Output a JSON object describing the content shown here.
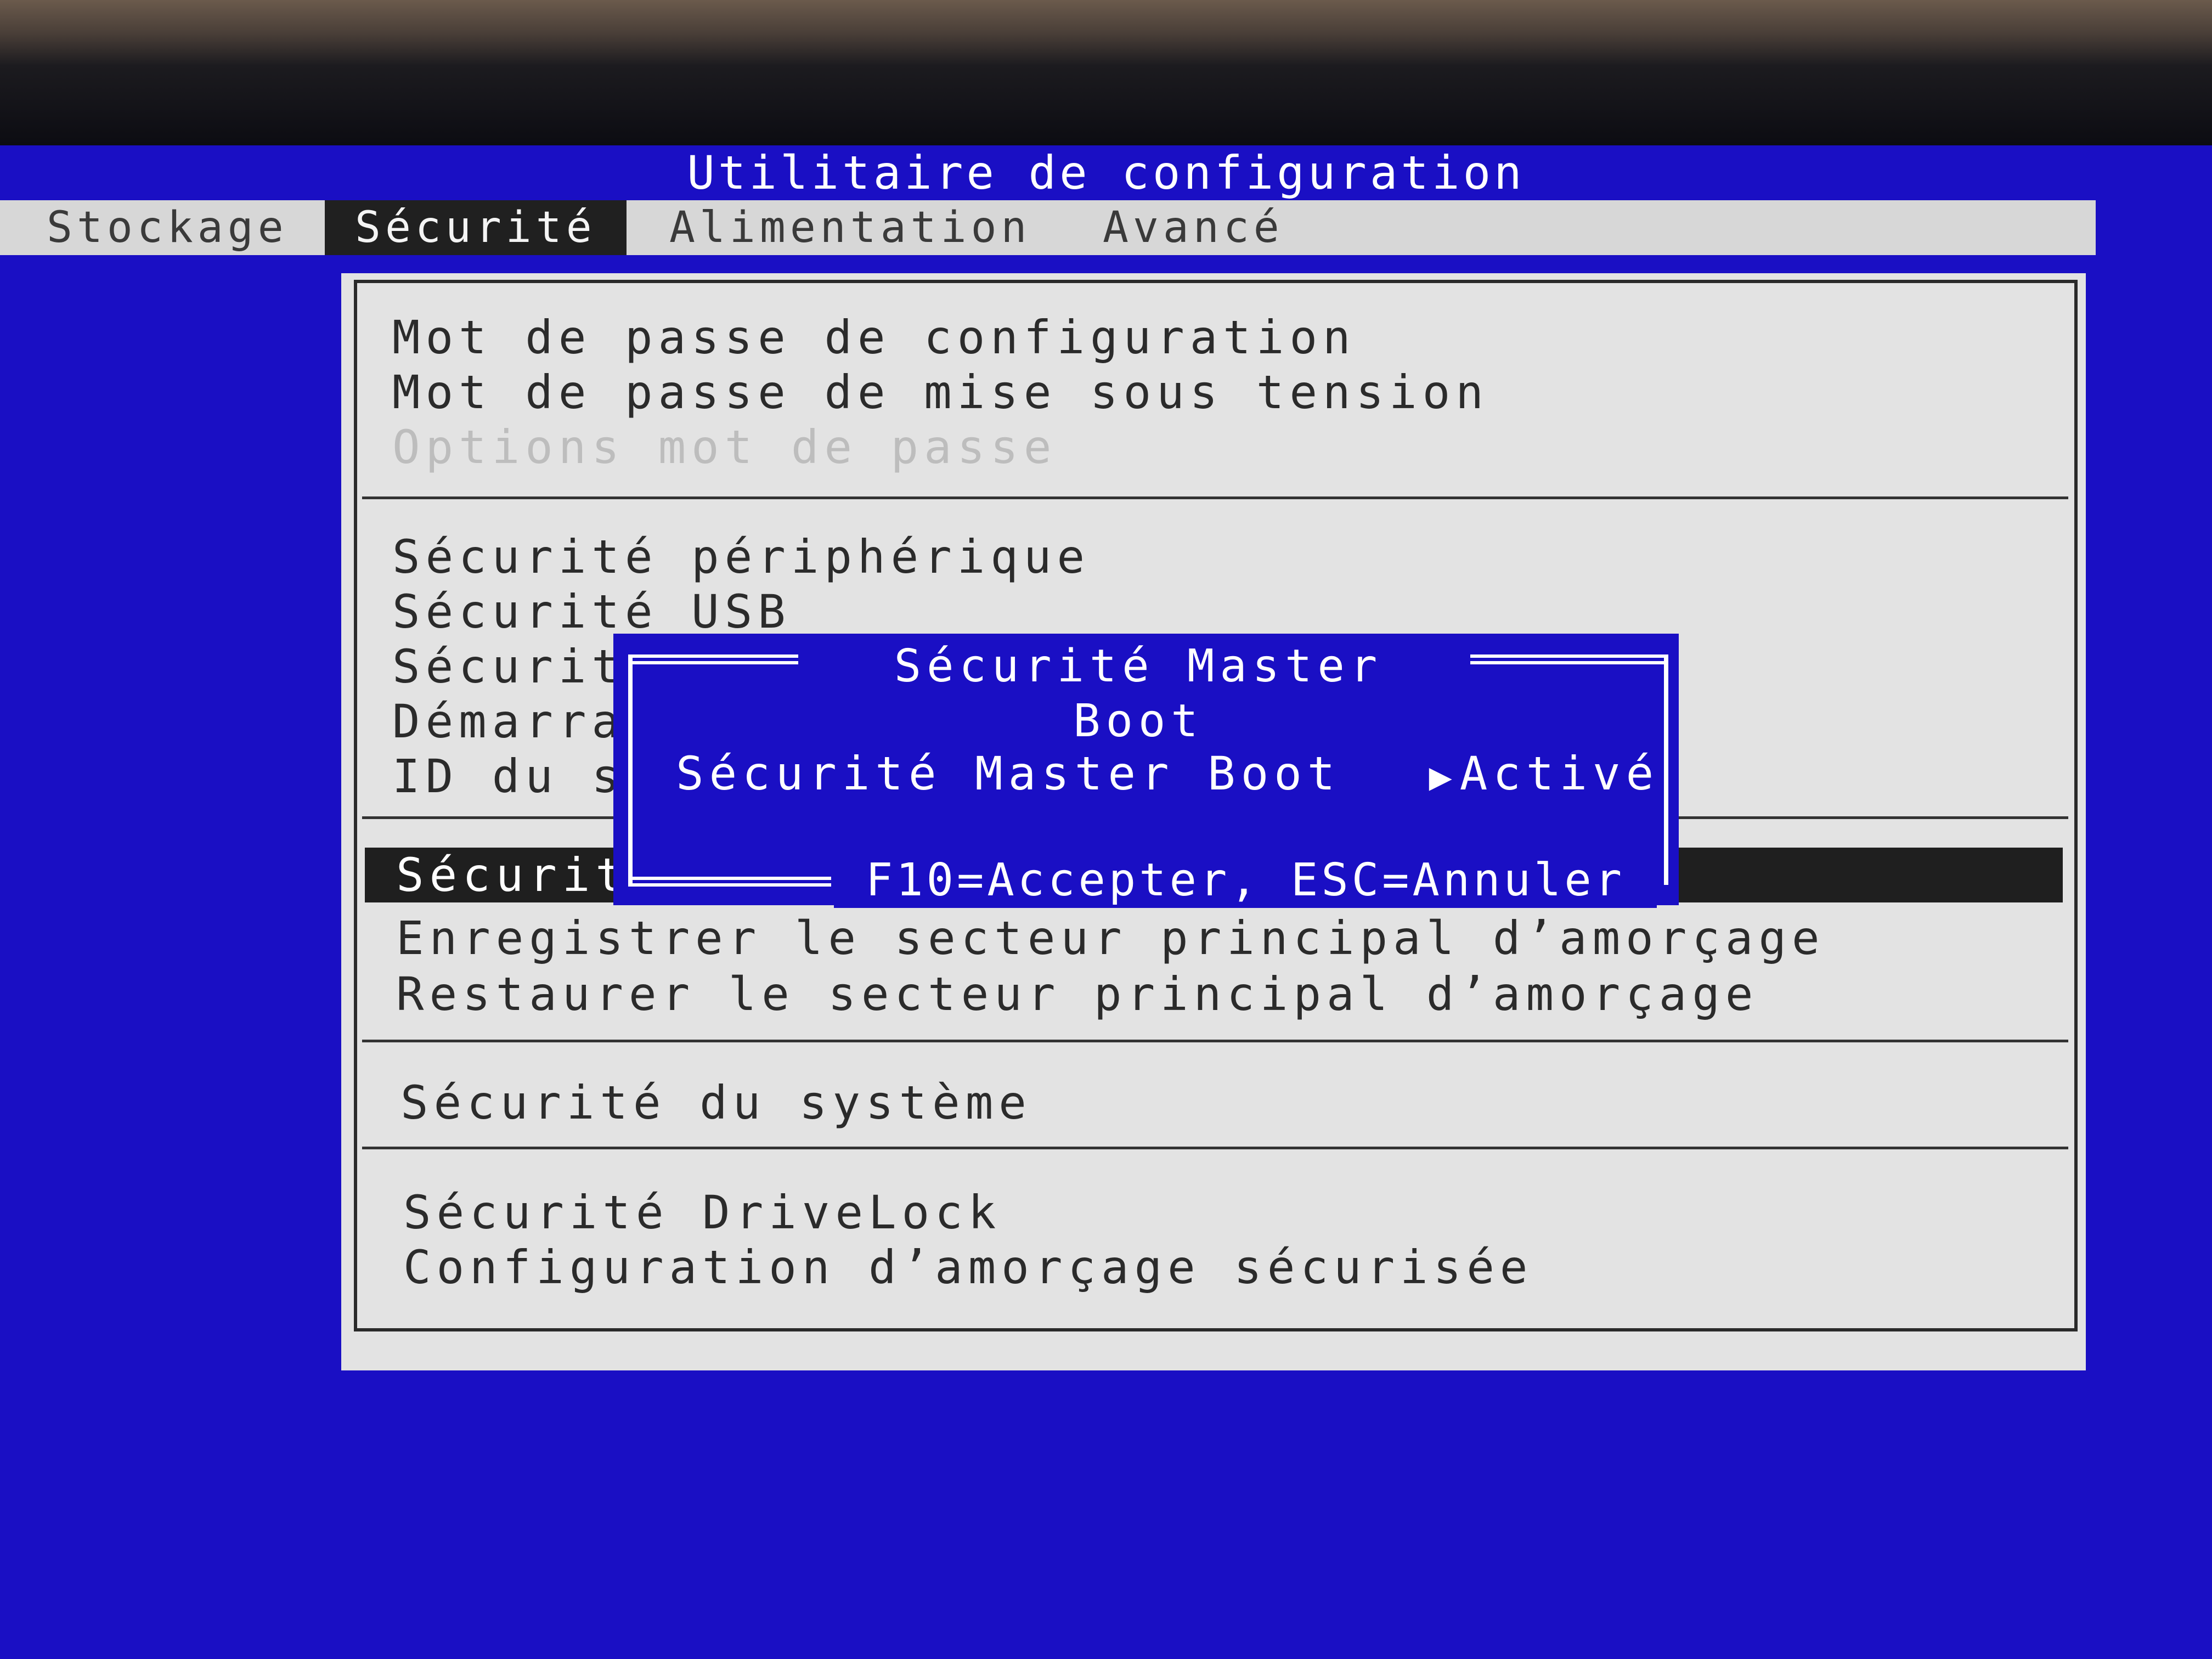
{
  "app": {
    "title": "Utilitaire de configuration"
  },
  "menu": {
    "items": [
      {
        "label": "Stockage"
      },
      {
        "label": "Sécurité"
      },
      {
        "label": "Alimentation"
      },
      {
        "label": "Avancé"
      }
    ],
    "active": "Sécurité"
  },
  "security_menu": {
    "group1": [
      {
        "label": "Mot de passe de configuration"
      },
      {
        "label": "Mot de passe de mise sous tension"
      },
      {
        "label": "Options mot de passe",
        "disabled": true
      }
    ],
    "group2": [
      {
        "label": "Sécurité périphérique"
      },
      {
        "label": "Sécurité USB"
      },
      {
        "label": "Sécurit"
      },
      {
        "label": "Démarra"
      },
      {
        "label": "ID du s"
      }
    ],
    "group3": [
      {
        "label": "Sécurit",
        "selected": true
      },
      {
        "label": "Enregistrer le secteur principal d’amorçage"
      },
      {
        "label": "Restaurer le secteur principal d’amorçage"
      }
    ],
    "group4": [
      {
        "label": "Sécurité du système"
      }
    ],
    "group5": [
      {
        "label": "Sécurité DriveLock"
      },
      {
        "label": "Configuration d’amorçage sécurisée"
      }
    ]
  },
  "dialog": {
    "title": "Sécurité Master Boot",
    "setting_label": "Sécurité Master Boot",
    "setting_value": "Activé",
    "arrow_icon": "triangle-right-icon",
    "footer": "F10=Accepter, ESC=Annuler"
  },
  "colors": {
    "background": "#1a0fc4",
    "panel": "#e3e3e3",
    "selection": "#1f1f1f"
  }
}
